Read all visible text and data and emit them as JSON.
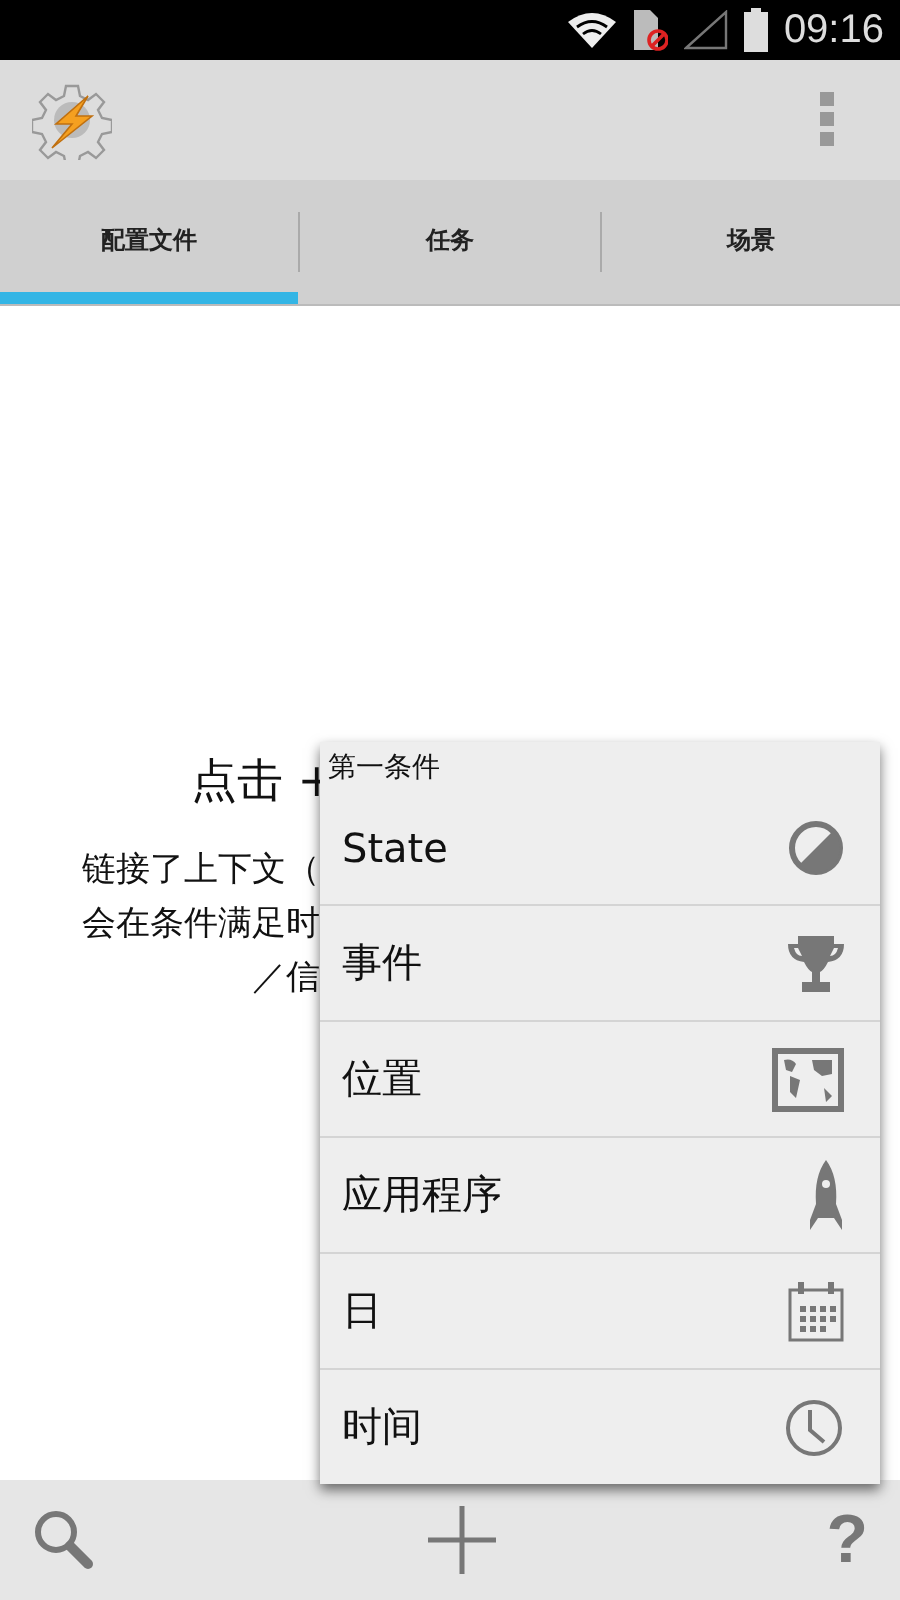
{
  "status_bar": {
    "time": "09:16"
  },
  "tabs": [
    {
      "label": "配置文件",
      "selected": true
    },
    {
      "label": "任务",
      "selected": false
    },
    {
      "label": "场景",
      "selected": false
    }
  ],
  "hint": {
    "title": "点击 +",
    "lines": [
      "链接了上下文（",
      "会在条件满足时",
      "／信"
    ]
  },
  "popup_menu": {
    "title": "第一条件",
    "items": [
      {
        "label": "State"
      },
      {
        "label": "事件"
      },
      {
        "label": "位置"
      },
      {
        "label": "应用程序"
      },
      {
        "label": "日"
      },
      {
        "label": "时间"
      }
    ]
  },
  "bottom_bar": {
    "help": "?"
  }
}
